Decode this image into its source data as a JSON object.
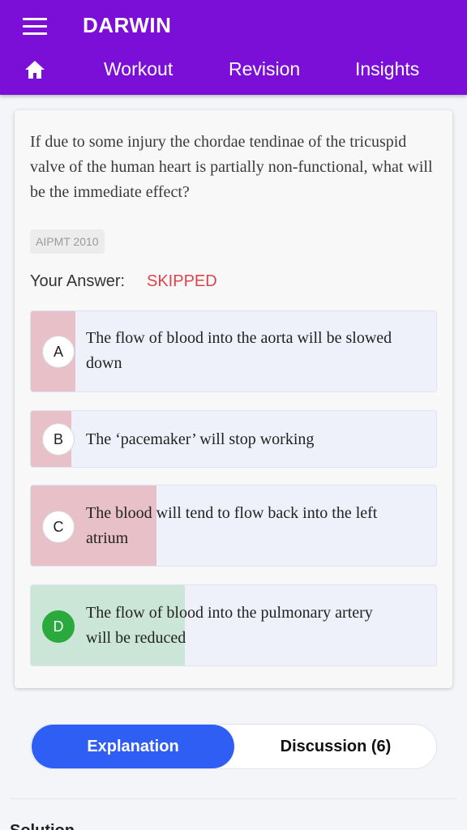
{
  "app": {
    "title": "DARWIN",
    "nav": [
      "Workout",
      "Revision",
      "Insights"
    ]
  },
  "question": {
    "text": "If due to some injury the chordae tendinae of the tricuspid valve of the human heart is partially non-functional, what will be the immediate effect?",
    "tag": "AIPMT 2010",
    "your_answer_label": "Your Answer:",
    "your_answer_value": "SKIPPED"
  },
  "options": [
    {
      "letter": "A",
      "text": "The flow of blood into the aorta will be slowed down",
      "response_share_pct": 11,
      "correct": false
    },
    {
      "letter": "B",
      "text": "The ‘pacemaker’ will stop working",
      "response_share_pct": 10,
      "correct": false
    },
    {
      "letter": "C",
      "text": "The blood will tend to flow back into the left atrium",
      "response_share_pct": 31,
      "correct": false
    },
    {
      "letter": "D",
      "text": "The flow of blood into the pulmonary artery will be reduced",
      "response_share_pct": 38,
      "correct": true
    }
  ],
  "tabs": {
    "explanation": "Explanation",
    "discussion": "Discussion (6)"
  },
  "solution_label": "Solution",
  "colors": {
    "header": "#7b0fd8",
    "skipped": "#e0424b",
    "wrong_fill": "#e8c0c8",
    "correct_fill": "#cbe6d7",
    "correct_badge": "#2aaa3c",
    "active_tab": "#2f5ef5"
  }
}
